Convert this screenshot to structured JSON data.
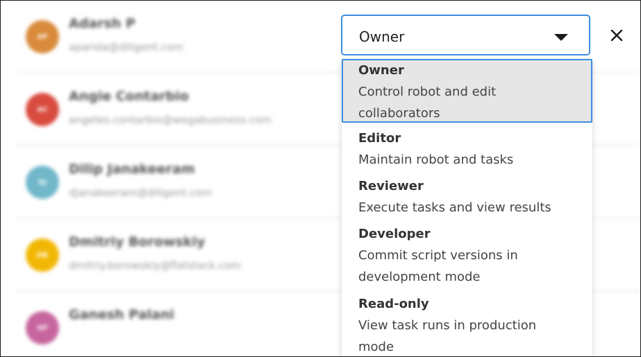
{
  "users": [
    {
      "initials": "AP",
      "name": "Adarsh P",
      "email": "aparida@diligent.com",
      "color": "#d98a3b"
    },
    {
      "initials": "AC",
      "name": "Angie Contarbio",
      "email": "angeles.contarbio@wegabusiness.com",
      "color": "#d94b3f"
    },
    {
      "initials": "DJ",
      "name": "Dilip Janakeeram",
      "email": "djanakeeram@diligent.com",
      "color": "#6fb7c9"
    },
    {
      "initials": "DB",
      "name": "Dmitriy Borowskiy",
      "email": "dmitriy.borowskiy@flatstack.com",
      "color": "#f2b705"
    },
    {
      "initials": "GP",
      "name": "Ganesh Palani",
      "email": "",
      "color": "#c7669e"
    }
  ],
  "role_select": {
    "value": "Owner"
  },
  "role_menu": {
    "options": [
      {
        "title": "Owner",
        "description": "Control robot and edit collaborators",
        "selected": true
      },
      {
        "title": "Editor",
        "description": "Maintain robot and tasks",
        "selected": false
      },
      {
        "title": "Reviewer",
        "description": "Execute tasks and view results",
        "selected": false
      },
      {
        "title": "Developer",
        "description": "Commit script versions in development mode",
        "selected": false
      },
      {
        "title": "Read-only",
        "description": "View task runs in production mode",
        "selected": false
      }
    ]
  },
  "icons": {
    "close": "close-icon",
    "caret": "chevron-down-icon"
  },
  "colors": {
    "focus_border": "#3b8de0",
    "selected_bg": "#e6e6e6"
  }
}
